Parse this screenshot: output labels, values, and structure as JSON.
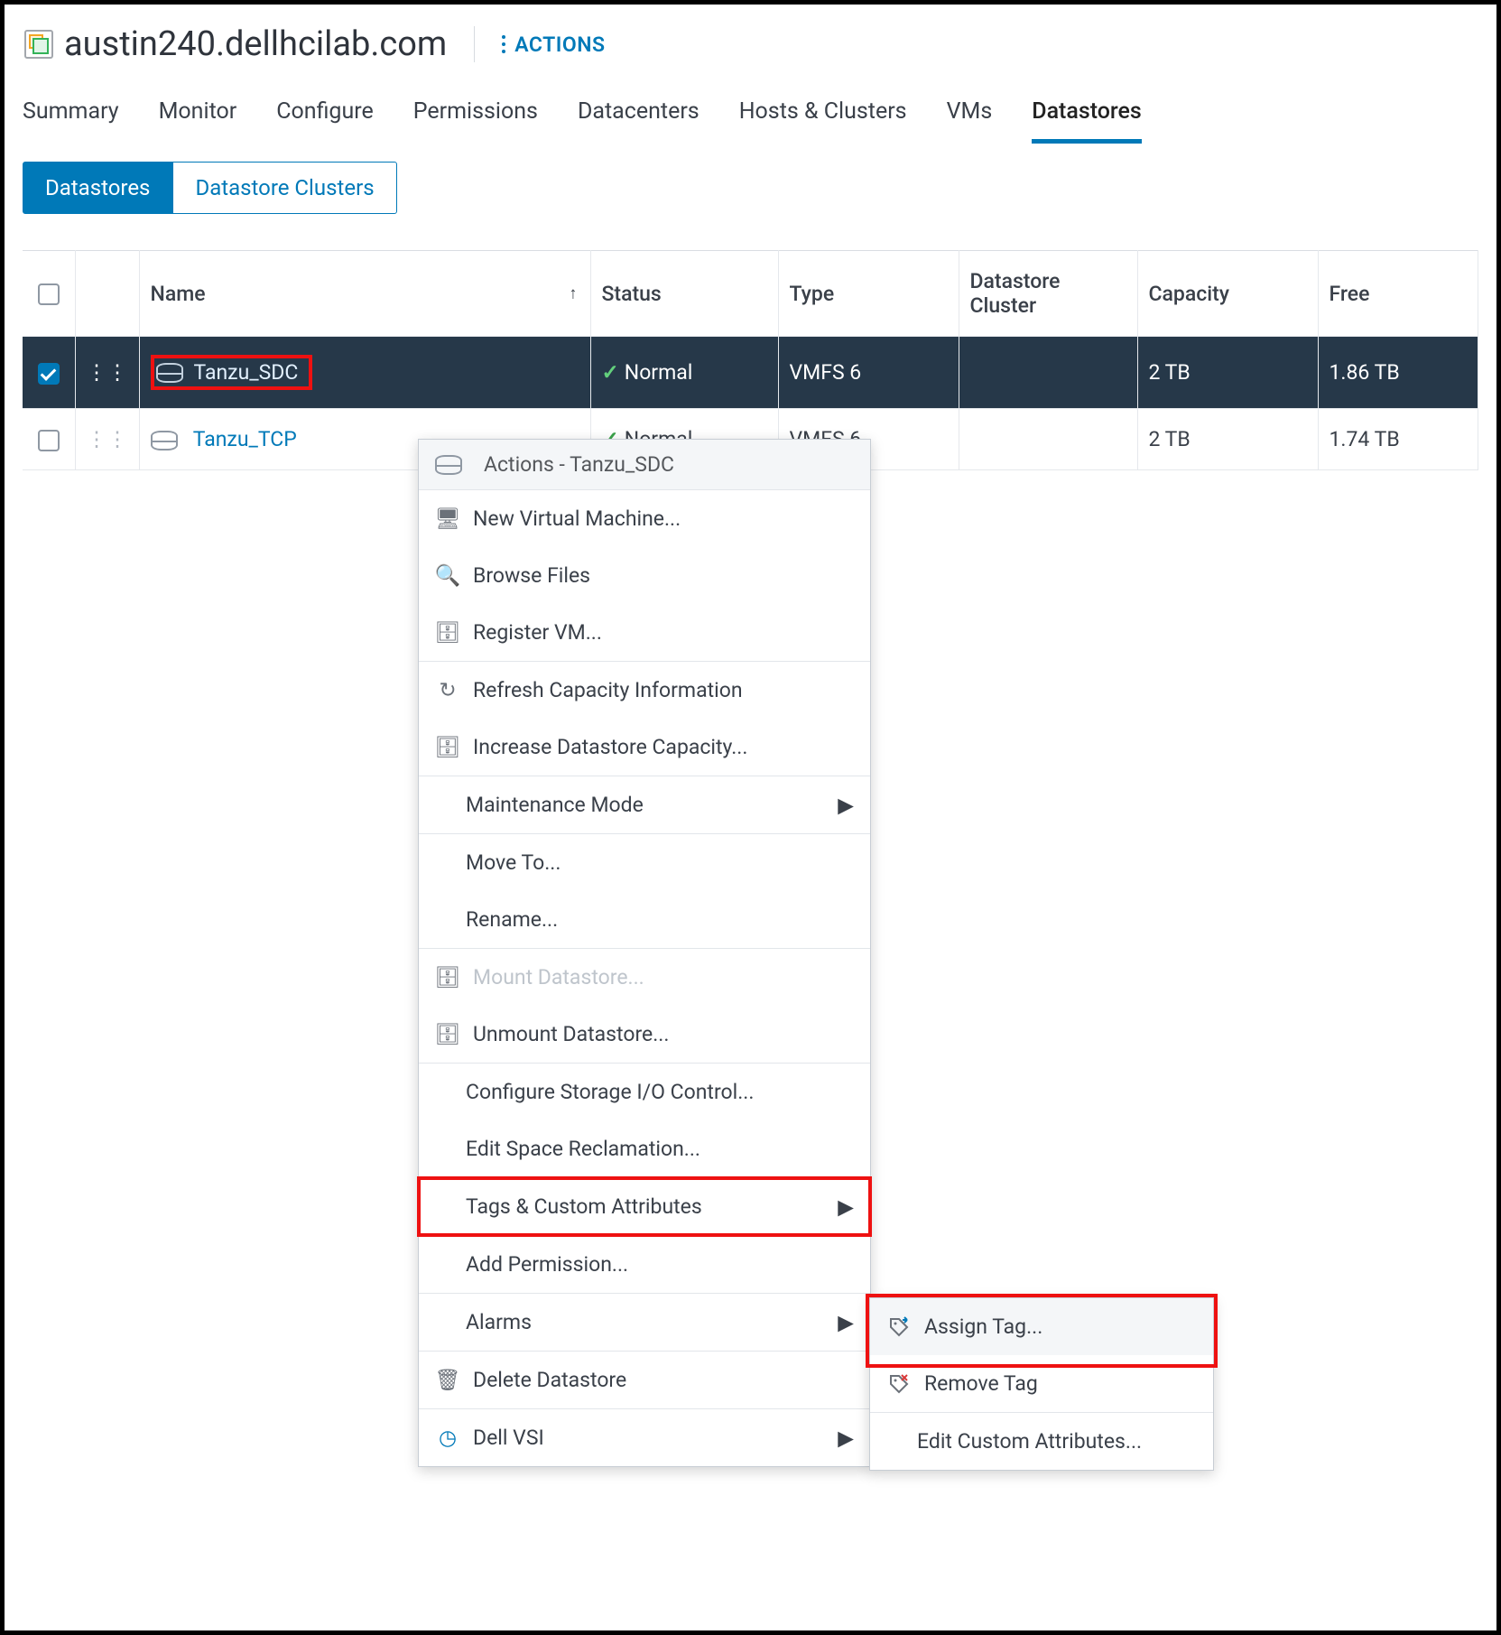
{
  "header": {
    "title": "austin240.dellhcilab.com",
    "actions_label": "ACTIONS"
  },
  "tabs": [
    "Summary",
    "Monitor",
    "Configure",
    "Permissions",
    "Datacenters",
    "Hosts & Clusters",
    "VMs",
    "Datastores"
  ],
  "active_tab_index": 7,
  "subtabs": {
    "primary": "Datastores",
    "secondary": "Datastore Clusters"
  },
  "table": {
    "columns": {
      "name": "Name",
      "status": "Status",
      "type": "Type",
      "cluster": "Datastore Cluster",
      "capacity": "Capacity",
      "free": "Free"
    },
    "rows": [
      {
        "checked": true,
        "name": "Tanzu_SDC",
        "status": "Normal",
        "type": "VMFS 6",
        "cluster": "",
        "capacity": "2 TB",
        "free": "1.86 TB"
      },
      {
        "checked": false,
        "name": "Tanzu_TCP",
        "status": "Normal",
        "type": "VMFS 6",
        "cluster": "",
        "capacity": "2 TB",
        "free": "1.74 TB"
      }
    ]
  },
  "context_menu": {
    "title": "Actions - Tanzu_SDC",
    "items": {
      "new_vm": "New Virtual Machine...",
      "browse": "Browse Files",
      "register": "Register VM...",
      "refresh": "Refresh Capacity Information",
      "increase": "Increase Datastore Capacity...",
      "maint": "Maintenance Mode",
      "move": "Move To...",
      "rename": "Rename...",
      "mount": "Mount Datastore...",
      "unmount": "Unmount Datastore...",
      "sioc": "Configure Storage I/O Control...",
      "reclaim": "Edit Space Reclamation...",
      "tags": "Tags & Custom Attributes",
      "addperm": "Add Permission...",
      "alarms": "Alarms",
      "delete": "Delete Datastore",
      "dellvsi": "Dell VSI"
    }
  },
  "submenu": {
    "assign": "Assign Tag...",
    "remove": "Remove Tag",
    "editattr": "Edit Custom Attributes..."
  }
}
